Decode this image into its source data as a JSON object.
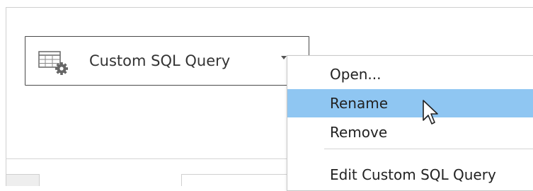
{
  "data_source_pill": {
    "label": "Custom SQL Query",
    "icon": "table-gear-icon",
    "caret_icon": "chevron-down-icon"
  },
  "context_menu": {
    "items": [
      {
        "label": "Open..."
      },
      {
        "label": "Rename",
        "highlighted": true
      },
      {
        "label": "Remove"
      },
      {
        "label": "Edit Custom SQL Query"
      }
    ]
  },
  "cursor": {
    "icon": "arrow-cursor-icon"
  },
  "colors": {
    "highlight": "#8fc6f2",
    "pill_border": "#4a4a4a",
    "text": "#222222"
  }
}
